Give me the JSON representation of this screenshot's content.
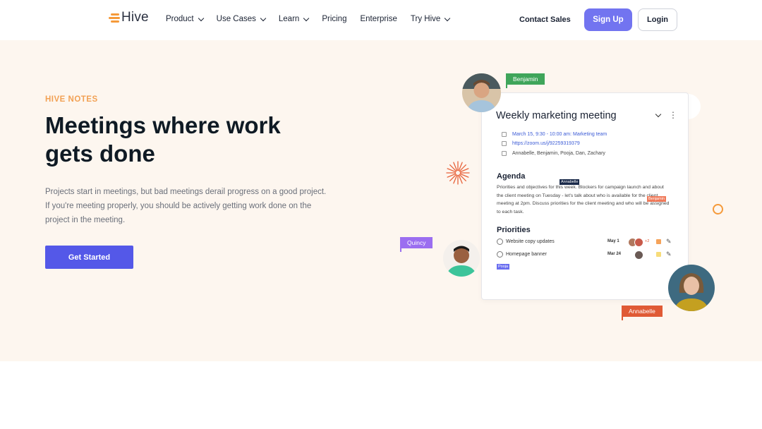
{
  "brand": {
    "name": "Hive",
    "accent": "#f59a3a"
  },
  "nav": {
    "items": [
      {
        "label": "Product",
        "dropdown": true
      },
      {
        "label": "Use Cases",
        "dropdown": true
      },
      {
        "label": "Learn",
        "dropdown": true
      },
      {
        "label": "Pricing",
        "dropdown": false
      },
      {
        "label": "Enterprise",
        "dropdown": false
      },
      {
        "label": "Try Hive",
        "dropdown": true
      }
    ],
    "contact_sales": "Contact Sales",
    "sign_up": "Sign Up",
    "login": "Login"
  },
  "hero": {
    "eyebrow": "HIVE NOTES",
    "headline": "Meetings where work gets done",
    "description": "Projects start in meetings, but bad meetings derail progress on a good project. If you're meeting properly, you should be actively getting work done on the project in the meeting.",
    "cta": "Get Started"
  },
  "meeting_card": {
    "title": "Weekly marketing meeting",
    "date": "March 15, 9:30 - 10:00 am: Marketing team",
    "link": "https://zoom.us/j/92259319379",
    "attendees": "Annabelle, Benjamin, Pooja, Dan, Zachary",
    "agenda_heading": "Agenda",
    "agenda_text": "Priorities and objectives for this week. Blockers for campaign launch and about the client meeting on Tuesday - let's talk about who is available for the client meeting at 2pm. Discuss priorities for the client meeting and who will be assigned to each task.",
    "priorities_heading": "Priorities",
    "priorities": [
      {
        "label": "Website copy updates",
        "date": "May 1",
        "extra": "+2",
        "color": "#f5a35a"
      },
      {
        "label": "Homepage banner",
        "date": "Mar 24",
        "color": "#f7dc7a"
      }
    ]
  },
  "people": {
    "benjamin": "Benjamin",
    "quincy": "Quincy",
    "annabelle": "Annabelle",
    "pooja": "Pooja"
  },
  "colors": {
    "benjamin_tag": "#3fa55a",
    "quincy_tag": "#9b6ef0",
    "annabelle_tag": "#e05a35",
    "pooja_tag": "#6a6ef0",
    "primary": "#5458e8"
  }
}
